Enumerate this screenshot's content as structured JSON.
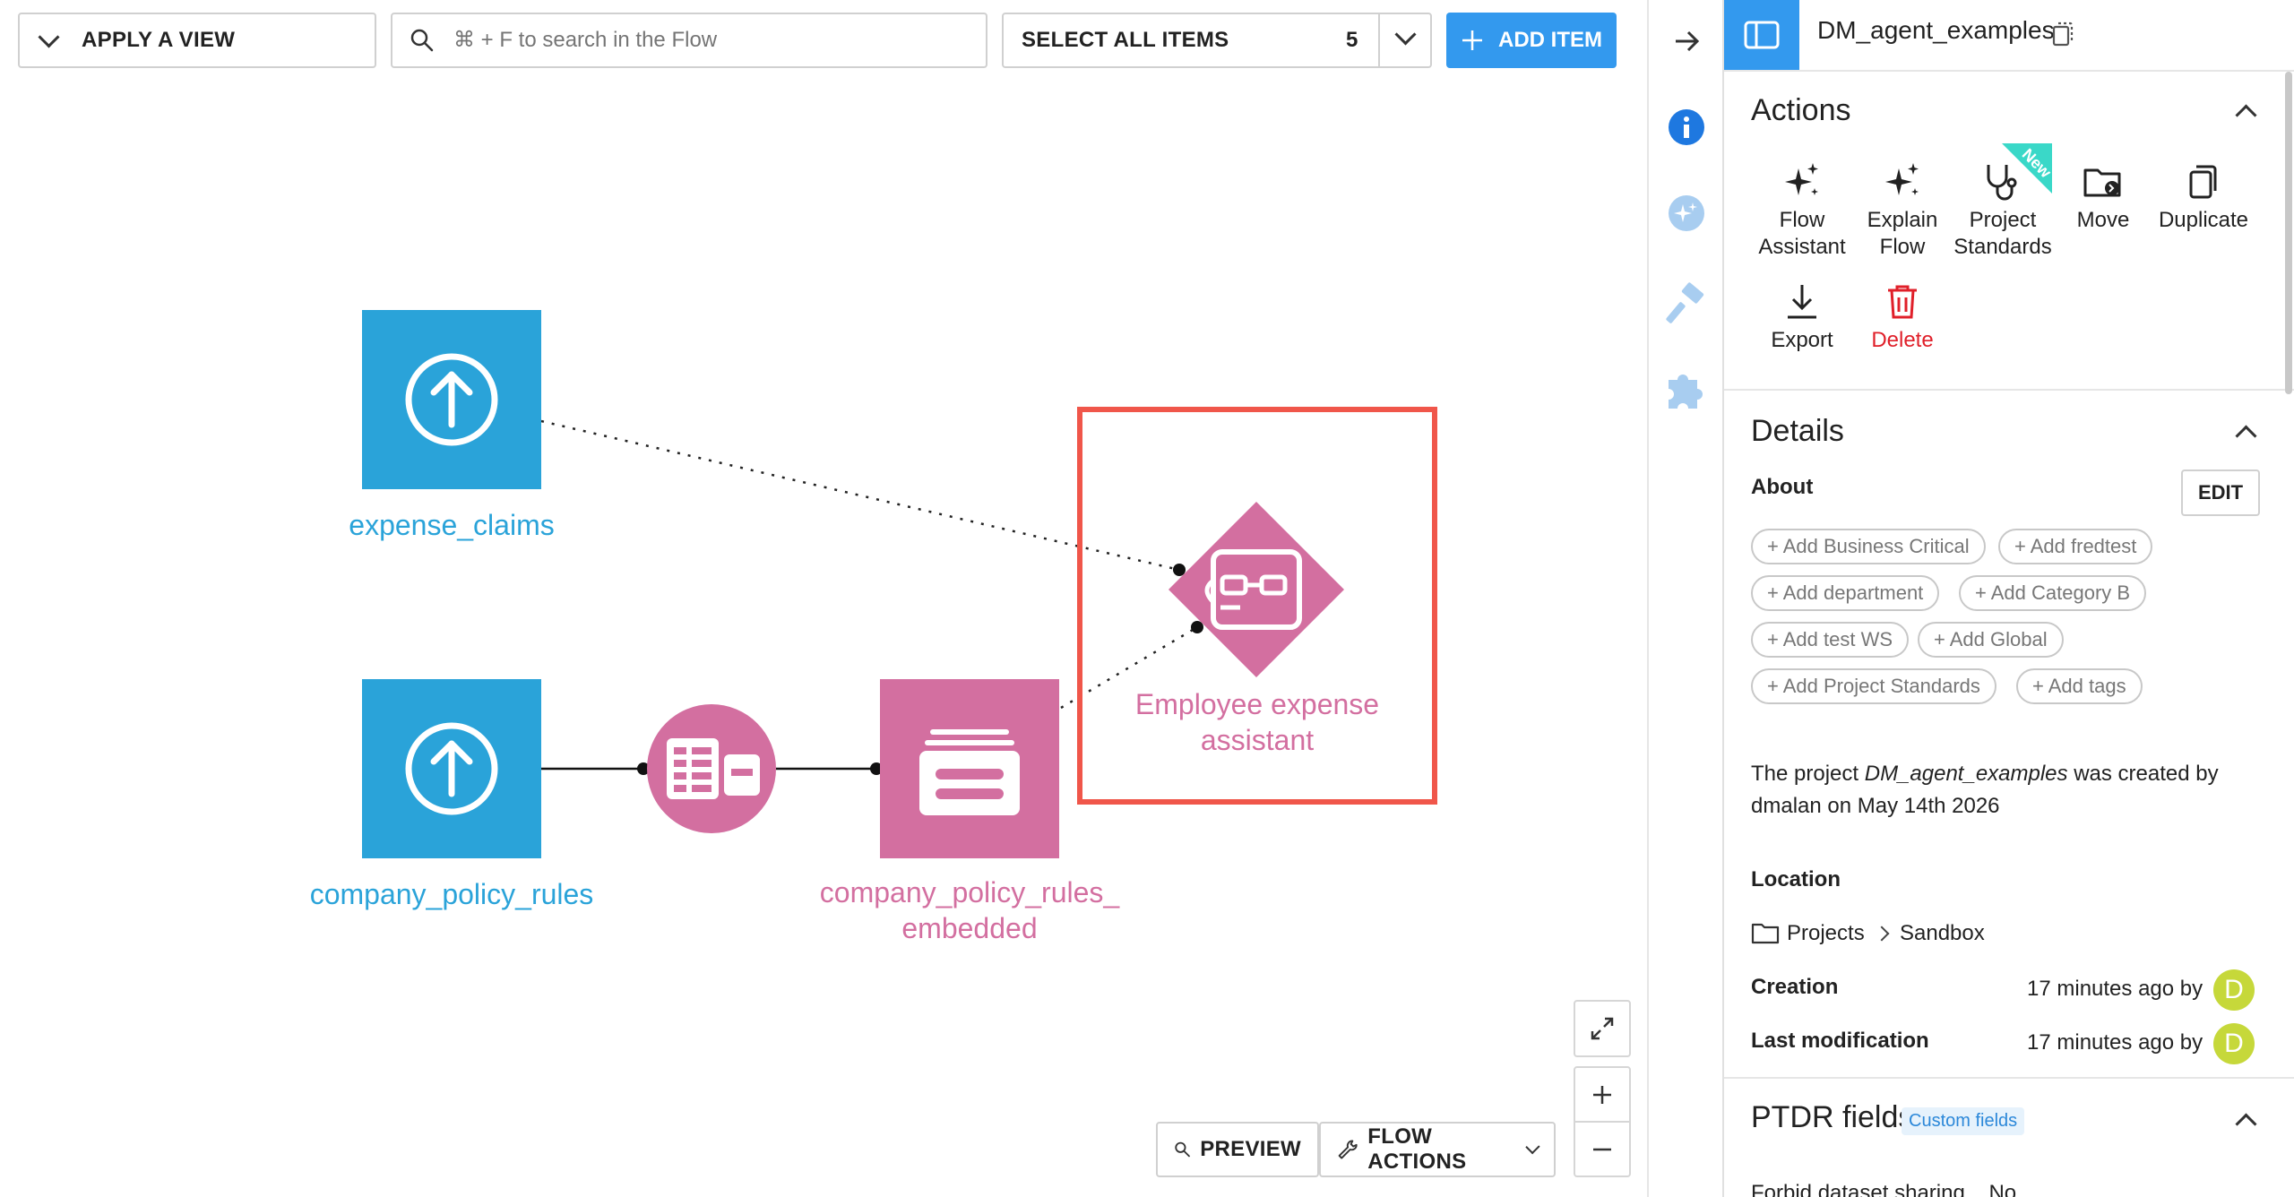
{
  "toolbar": {
    "apply_view": "APPLY A VIEW",
    "search_placeholder": "⌘ + F to search in the Flow",
    "select_all": "SELECT ALL ITEMS",
    "select_count": "5",
    "add_item": "ADD ITEM"
  },
  "flow": {
    "nodes": {
      "expense_claims": "expense_claims",
      "company_policy_rules": "company_policy_rules",
      "embedded_line1": "company_policy_rules_",
      "embedded_line2": "embedded",
      "agent_line1": "Employee expense",
      "agent_line2": "assistant"
    },
    "bottom": {
      "preview": "PREVIEW",
      "flow_actions": "FLOW ACTIONS"
    }
  },
  "panel": {
    "project_name": "DM_agent_examples",
    "actions_title": "Actions",
    "actions": [
      {
        "line1": "Flow",
        "line2": "Assistant"
      },
      {
        "line1": "Explain",
        "line2": "Flow"
      },
      {
        "line1": "Project",
        "line2": "Standards"
      },
      {
        "line1": "Move",
        "line2": ""
      },
      {
        "line1": "Duplicate",
        "line2": ""
      },
      {
        "line1": "Export",
        "line2": ""
      },
      {
        "line1": "Delete",
        "line2": ""
      }
    ],
    "new_badge": "New",
    "details_title": "Details",
    "about": "About",
    "edit": "EDIT",
    "tags": [
      "+ Add Business Critical",
      "+ Add fredtest",
      "+ Add department",
      "+ Add Category B",
      "+ Add test WS",
      "+ Add Global",
      "+ Add Project Standards",
      "+ Add tags"
    ],
    "desc_prefix": "The project ",
    "desc_project": "DM_agent_examples",
    "desc_suffix": " was created by",
    "desc_line2": "dmalan on May 14th 2026",
    "location_label": "Location",
    "location_root": "Projects",
    "location_child": "Sandbox",
    "creation_label": "Creation",
    "creation_value": "17 minutes ago by",
    "modification_label": "Last modification",
    "modification_value": "17 minutes ago by",
    "avatar_letter": "D",
    "ptdr_title": "PTDR fields",
    "custom_fields": "Custom fields",
    "cut_row": "Forbid dataset sharing    No"
  },
  "colors": {
    "accent": "#3399ee",
    "dataset_blue": "#2aa3d9",
    "recipe_pink": "#d36fa0",
    "selection_red": "#f0564a",
    "delete_red": "#e0202a",
    "avatar_green": "#c6d83a",
    "badge_teal": "#3ad8c8"
  }
}
